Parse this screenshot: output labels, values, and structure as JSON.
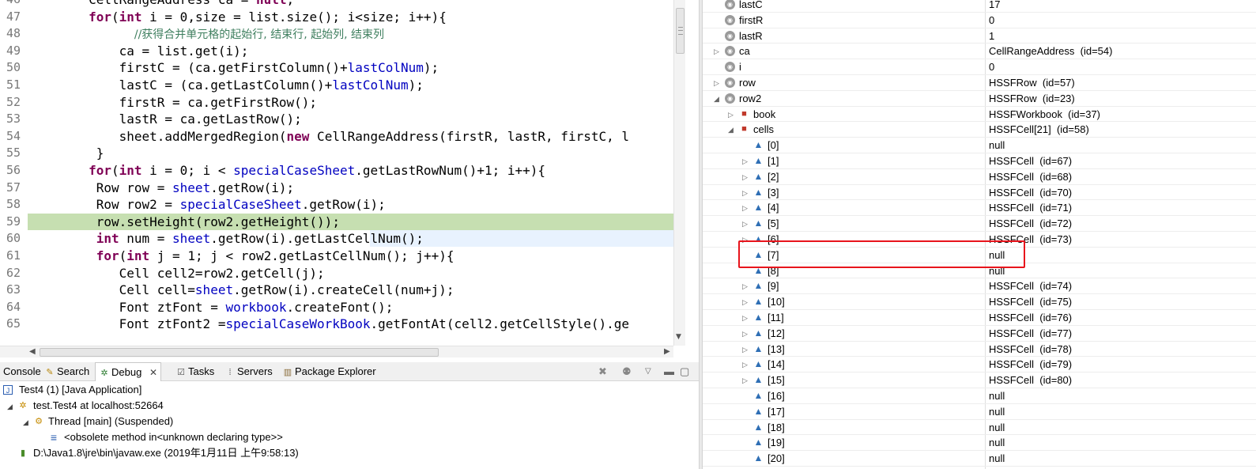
{
  "editor": {
    "line_numbers": [
      "46",
      "47",
      "48",
      "49",
      "50",
      "51",
      "52",
      "53",
      "54",
      "55",
      "56",
      "57",
      "58",
      "59",
      "60",
      "61",
      "62",
      "63",
      "64",
      "65"
    ],
    "lines": [
      [
        {
          "t": "        CellRangeAddress ca = ",
          "c": ""
        },
        {
          "t": "null",
          "c": "kw"
        },
        {
          "t": ";",
          "c": ""
        }
      ],
      [
        {
          "t": "        ",
          "c": ""
        },
        {
          "t": "for",
          "c": "kw"
        },
        {
          "t": "(",
          "c": ""
        },
        {
          "t": "int",
          "c": "kw"
        },
        {
          "t": " i = 0,size = list.size(); i<size; i++){",
          "c": ""
        }
      ],
      [
        {
          "t": "              ",
          "c": ""
        },
        {
          "t": "//获得合并单元格的起始行, 结束行, 起始列, 结束列",
          "c": "cm"
        }
      ],
      [
        {
          "t": "            ca = list.get(i);",
          "c": ""
        }
      ],
      [
        {
          "t": "            firstC = (ca.getFirstColumn()+",
          "c": ""
        },
        {
          "t": "lastColNum",
          "c": "fd"
        },
        {
          "t": ");",
          "c": ""
        }
      ],
      [
        {
          "t": "            lastC = (ca.getLastColumn()+",
          "c": ""
        },
        {
          "t": "lastColNum",
          "c": "fd"
        },
        {
          "t": ");",
          "c": ""
        }
      ],
      [
        {
          "t": "            firstR = ca.getFirstRow();",
          "c": ""
        }
      ],
      [
        {
          "t": "            lastR = ca.getLastRow();",
          "c": ""
        }
      ],
      [
        {
          "t": "            sheet.addMergedRegion(",
          "c": ""
        },
        {
          "t": "new",
          "c": "kw"
        },
        {
          "t": " CellRangeAddress(firstR, lastR, firstC, l",
          "c": ""
        }
      ],
      [
        {
          "t": "         }",
          "c": ""
        }
      ],
      [
        {
          "t": "        ",
          "c": ""
        },
        {
          "t": "for",
          "c": "kw"
        },
        {
          "t": "(",
          "c": ""
        },
        {
          "t": "int",
          "c": "kw"
        },
        {
          "t": " i = 0; i < ",
          "c": ""
        },
        {
          "t": "specialCaseSheet",
          "c": "fd"
        },
        {
          "t": ".getLastRowNum()+1; i++){",
          "c": ""
        }
      ],
      [
        {
          "t": "         Row row = ",
          "c": ""
        },
        {
          "t": "sheet",
          "c": "fd"
        },
        {
          "t": ".getRow(i);",
          "c": ""
        }
      ],
      [
        {
          "t": "         Row row2 = ",
          "c": ""
        },
        {
          "t": "specialCaseSheet",
          "c": "fd"
        },
        {
          "t": ".getRow(i);",
          "c": ""
        }
      ],
      [
        {
          "t": "         row.setHeight(row2.getHeight());",
          "c": ""
        }
      ],
      [
        {
          "t": "         ",
          "c": ""
        },
        {
          "t": "int",
          "c": "kw"
        },
        {
          "t": " num = ",
          "c": ""
        },
        {
          "t": "sheet",
          "c": "fd"
        },
        {
          "t": ".getRow(i).getLastCellNum();",
          "c": ""
        }
      ],
      [
        {
          "t": "         ",
          "c": ""
        },
        {
          "t": "for",
          "c": "kw"
        },
        {
          "t": "(",
          "c": ""
        },
        {
          "t": "int",
          "c": "kw"
        },
        {
          "t": " j = 1; j < row2.getLastCellNum(); j++){",
          "c": ""
        }
      ],
      [
        {
          "t": "            Cell cell2=row2.getCell(j);",
          "c": ""
        }
      ],
      [
        {
          "t": "            Cell cell=",
          "c": ""
        },
        {
          "t": "sheet",
          "c": "fd"
        },
        {
          "t": ".getRow(i).createCell(num+j);",
          "c": ""
        }
      ],
      [
        {
          "t": "            Font ztFont = ",
          "c": ""
        },
        {
          "t": "workbook",
          "c": "fd"
        },
        {
          "t": ".createFont();",
          "c": ""
        }
      ],
      [
        {
          "t": "            Font ztFont2 =",
          "c": ""
        },
        {
          "t": "specialCaseWorkBook",
          "c": "fd"
        },
        {
          "t": ".getFontAt(cell2.getCellStyle().ge",
          "c": ""
        }
      ]
    ],
    "highlighted_line_index": 13
  },
  "debug_view": {
    "tabs": [
      {
        "label": "Console",
        "icon": "console-icon",
        "active": false
      },
      {
        "label": "Search",
        "icon": "search-icon",
        "active": false
      },
      {
        "label": "Debug",
        "icon": "bug-icon",
        "active": true
      },
      {
        "label": "Tasks",
        "icon": "tasks-icon",
        "active": false
      },
      {
        "label": "Servers",
        "icon": "servers-icon",
        "active": false
      },
      {
        "label": "Package Explorer",
        "icon": "package-icon",
        "active": false
      }
    ],
    "tree": [
      {
        "label": "Test4 (1) [Java Application]",
        "icon": "java-app-icon",
        "level": 0,
        "expanded": false
      },
      {
        "label": "test.Test4 at localhost:52664",
        "icon": "debug-target-icon",
        "level": 1,
        "expanded": true
      },
      {
        "label": "Thread [main] (Suspended)",
        "icon": "thread-icon",
        "level": 2,
        "expanded": true
      },
      {
        "label": "<obsolete method in<unknown declaring type>>",
        "icon": "stack-frame-icon",
        "level": 3,
        "expanded": false
      },
      {
        "label": "D:\\Java1.8\\jre\\bin\\javaw.exe (2019年1月11日 上午9:58:13)",
        "icon": "process-icon",
        "level": 1,
        "expanded": false
      }
    ]
  },
  "variables": {
    "rows": [
      {
        "name": "lastC",
        "value": "17",
        "kind": "local",
        "level": 0,
        "twistie": ""
      },
      {
        "name": "firstR",
        "value": "0",
        "kind": "local",
        "level": 0,
        "twistie": ""
      },
      {
        "name": "lastR",
        "value": "1",
        "kind": "local",
        "level": 0,
        "twistie": ""
      },
      {
        "name": "ca",
        "value": "CellRangeAddress  (id=54)",
        "kind": "local",
        "level": 0,
        "twistie": "collapsed"
      },
      {
        "name": "i",
        "value": "0",
        "kind": "local",
        "level": 0,
        "twistie": ""
      },
      {
        "name": "row",
        "value": "HSSFRow  (id=57)",
        "kind": "local",
        "level": 0,
        "twistie": "collapsed"
      },
      {
        "name": "row2",
        "value": "HSSFRow  (id=23)",
        "kind": "local",
        "level": 0,
        "twistie": "expanded"
      },
      {
        "name": "book",
        "value": "HSSFWorkbook  (id=37)",
        "kind": "field-final",
        "level": 1,
        "twistie": "collapsed"
      },
      {
        "name": "cells",
        "value": "HSSFCell[21]  (id=58)",
        "kind": "field",
        "level": 1,
        "twistie": "expanded"
      },
      {
        "name": "[0]",
        "value": "null",
        "kind": "element",
        "level": 2,
        "twistie": ""
      },
      {
        "name": "[1]",
        "value": "HSSFCell  (id=67)",
        "kind": "element",
        "level": 2,
        "twistie": "collapsed"
      },
      {
        "name": "[2]",
        "value": "HSSFCell  (id=68)",
        "kind": "element",
        "level": 2,
        "twistie": "collapsed"
      },
      {
        "name": "[3]",
        "value": "HSSFCell  (id=70)",
        "kind": "element",
        "level": 2,
        "twistie": "collapsed"
      },
      {
        "name": "[4]",
        "value": "HSSFCell  (id=71)",
        "kind": "element",
        "level": 2,
        "twistie": "collapsed"
      },
      {
        "name": "[5]",
        "value": "HSSFCell  (id=72)",
        "kind": "element",
        "level": 2,
        "twistie": "collapsed"
      },
      {
        "name": "[6]",
        "value": "HSSFCell  (id=73)",
        "kind": "element",
        "level": 2,
        "twistie": "collapsed"
      },
      {
        "name": "[7]",
        "value": "null",
        "kind": "element",
        "level": 2,
        "twistie": ""
      },
      {
        "name": "[8]",
        "value": "null",
        "kind": "element",
        "level": 2,
        "twistie": ""
      },
      {
        "name": "[9]",
        "value": "HSSFCell  (id=74)",
        "kind": "element",
        "level": 2,
        "twistie": "collapsed"
      },
      {
        "name": "[10]",
        "value": "HSSFCell  (id=75)",
        "kind": "element",
        "level": 2,
        "twistie": "collapsed"
      },
      {
        "name": "[11]",
        "value": "HSSFCell  (id=76)",
        "kind": "element",
        "level": 2,
        "twistie": "collapsed"
      },
      {
        "name": "[12]",
        "value": "HSSFCell  (id=77)",
        "kind": "element",
        "level": 2,
        "twistie": "collapsed"
      },
      {
        "name": "[13]",
        "value": "HSSFCell  (id=78)",
        "kind": "element",
        "level": 2,
        "twistie": "collapsed"
      },
      {
        "name": "[14]",
        "value": "HSSFCell  (id=79)",
        "kind": "element",
        "level": 2,
        "twistie": "collapsed"
      },
      {
        "name": "[15]",
        "value": "HSSFCell  (id=80)",
        "kind": "element",
        "level": 2,
        "twistie": "collapsed"
      },
      {
        "name": "[16]",
        "value": "null",
        "kind": "element",
        "level": 2,
        "twistie": ""
      },
      {
        "name": "[17]",
        "value": "null",
        "kind": "element",
        "level": 2,
        "twistie": ""
      },
      {
        "name": "[18]",
        "value": "null",
        "kind": "element",
        "level": 2,
        "twistie": ""
      },
      {
        "name": "[19]",
        "value": "null",
        "kind": "element",
        "level": 2,
        "twistie": ""
      },
      {
        "name": "[20]",
        "value": "null",
        "kind": "element",
        "level": 2,
        "twistie": ""
      }
    ]
  },
  "colors": {
    "keyword": "#7f0055",
    "field": "#0000c0",
    "comment": "#3f7f5f",
    "current_line": "#c6dfb1",
    "annotation_box": "#e8141c"
  }
}
